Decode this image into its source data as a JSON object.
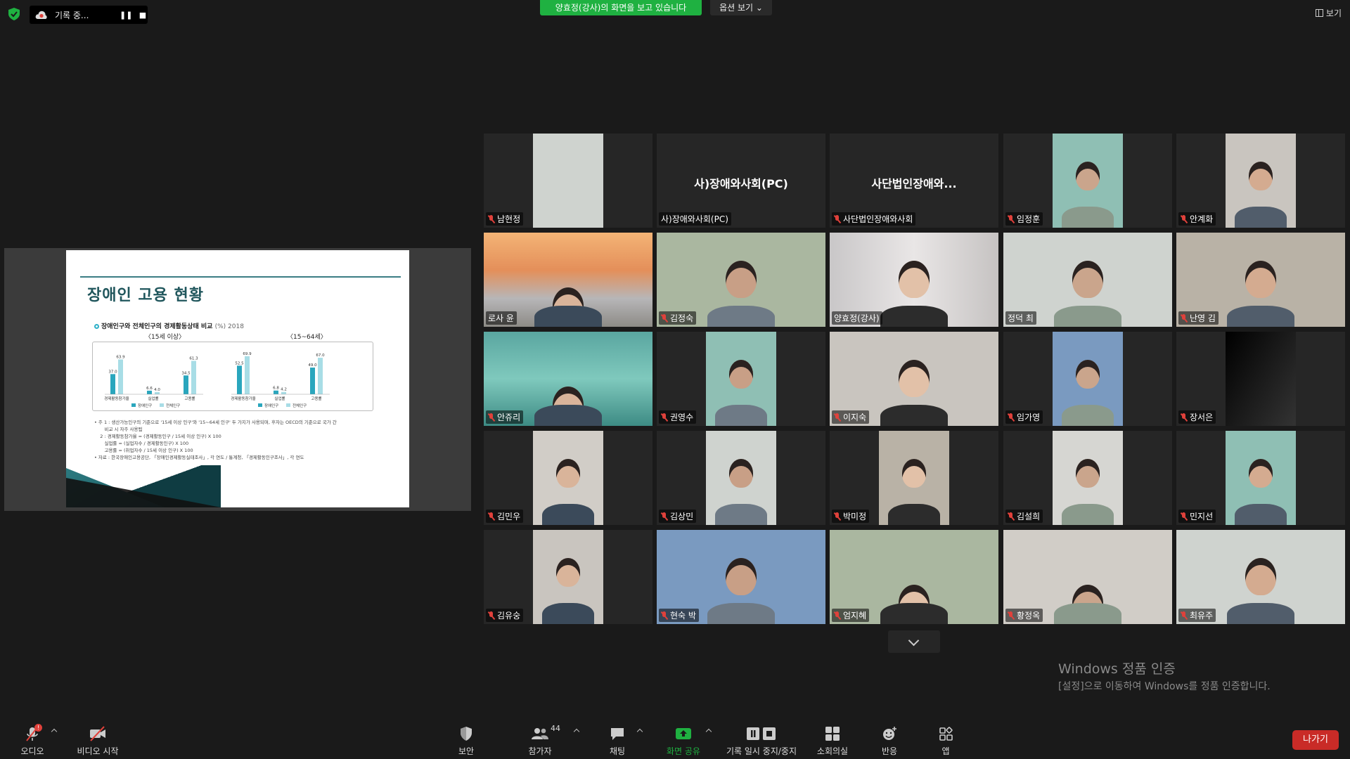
{
  "topbar": {
    "recording_text": "기록 중...",
    "pause_glyph": "❚❚",
    "stop_glyph": "■",
    "share_banner": "양효정(강사)의 화면을 보고 있습니다",
    "view_options": "옵션 보기 ⌄",
    "view_button": "보기"
  },
  "slide": {
    "title": "장애인 고용 현황",
    "subtitle": "장애인구와 전체인구의 경제활동상태 비교",
    "subtitle_unit": "(%) 2018",
    "group_left": "〈15세 이상〉",
    "group_right": "〈15~64세〉",
    "legend_disabled": "장애인구",
    "legend_total": "전체인구",
    "notes": [
      "• 주 1 : 생산가능인구의 기준으로 '15세 이상 인구'와 '15~64세 인구' 두 가지가 사용되며, 후자는 OECD의 기준으로 국가 간",
      "       비교 시 자주 사용됨",
      "    2 : 경제활동참가율 = (경제활동인구 / 15세 이상 인구) X 100",
      "       실업률 = (실업자수 / 경제활동인구) X 100",
      "       고용률 = (취업자수 / 15세 이상 인구) X 100",
      "• 자료 : 한국장애인고용공단, 「장애인경제활동실태조사」, 각 연도 / 통계청, 「경제활동인구조사」, 각 연도"
    ]
  },
  "chart_data": {
    "type": "bar",
    "title": "장애인구와 전체인구의 경제활동상태 비교",
    "groups": [
      {
        "name": "〈15세 이상〉",
        "categories": [
          "경제활동참가율",
          "실업률",
          "고용률"
        ],
        "series": [
          {
            "name": "장애인구",
            "values": [
              37.0,
              6.6,
              34.5
            ]
          },
          {
            "name": "전체인구",
            "values": [
              63.9,
              4.0,
              61.3
            ]
          }
        ]
      },
      {
        "name": "〈15~64세〉",
        "categories": [
          "경제활동참가율",
          "실업률",
          "고용률"
        ],
        "series": [
          {
            "name": "장애인구",
            "values": [
              52.5,
              6.8,
              49.0
            ]
          },
          {
            "name": "전체인구",
            "values": [
              69.9,
              4.2,
              67.0
            ]
          }
        ]
      }
    ],
    "colors": {
      "장애인구": "#2aa6bd",
      "전체인구": "#a8dde6"
    },
    "ylim": [
      0,
      80
    ],
    "legend": "bottom"
  },
  "participants": [
    {
      "name": "남현정",
      "muted": true
    },
    {
      "name": "사)장애와사회(PC)",
      "muted": false,
      "title": "사)장애와사회(PC)"
    },
    {
      "name": "사단법인장애와사회",
      "muted": true,
      "title": "사단법인장애와..."
    },
    {
      "name": "임정훈",
      "muted": true
    },
    {
      "name": "안계화",
      "muted": true
    },
    {
      "name": "로사 윤",
      "muted": false
    },
    {
      "name": "김정숙",
      "muted": true
    },
    {
      "name": "양효정(강사)",
      "muted": false,
      "active": true
    },
    {
      "name": "정덕 최",
      "muted": false
    },
    {
      "name": "난영 김",
      "muted": true
    },
    {
      "name": "안쥬리",
      "muted": true
    },
    {
      "name": "권영수",
      "muted": true
    },
    {
      "name": "이지숙",
      "muted": true
    },
    {
      "name": "임가영",
      "muted": true
    },
    {
      "name": "장서은",
      "muted": true
    },
    {
      "name": "김민우",
      "muted": true
    },
    {
      "name": "김상민",
      "muted": true
    },
    {
      "name": "박미정",
      "muted": true
    },
    {
      "name": "김설희",
      "muted": true
    },
    {
      "name": "민지선",
      "muted": true
    },
    {
      "name": "김유숭",
      "muted": true
    },
    {
      "name": "현숙 박",
      "muted": true
    },
    {
      "name": "엄지혜",
      "muted": true
    },
    {
      "name": "황정옥",
      "muted": true
    },
    {
      "name": "최유주",
      "muted": true
    }
  ],
  "windows_activation": {
    "title": "Windows 정품 인증",
    "message": "[설정]으로 이동하여 Windows를 정품 인증합니다."
  },
  "toolbar": {
    "audio": "오디오",
    "audio_badge": "!",
    "video": "비디오 시작",
    "security": "보안",
    "participants": "참가자",
    "participants_count": "44",
    "chat": "채팅",
    "share": "화면 공유",
    "record": "기록 일시 중지/중지",
    "breakout": "소회의실",
    "reactions": "반응",
    "apps": "앱",
    "leave": "나가기"
  },
  "colors": {
    "share_banner": "#1fb141",
    "share_label": "#1fb141",
    "leave": "#c92b27",
    "muted": "#e0413b",
    "active_speaker": "#e8e84a"
  }
}
